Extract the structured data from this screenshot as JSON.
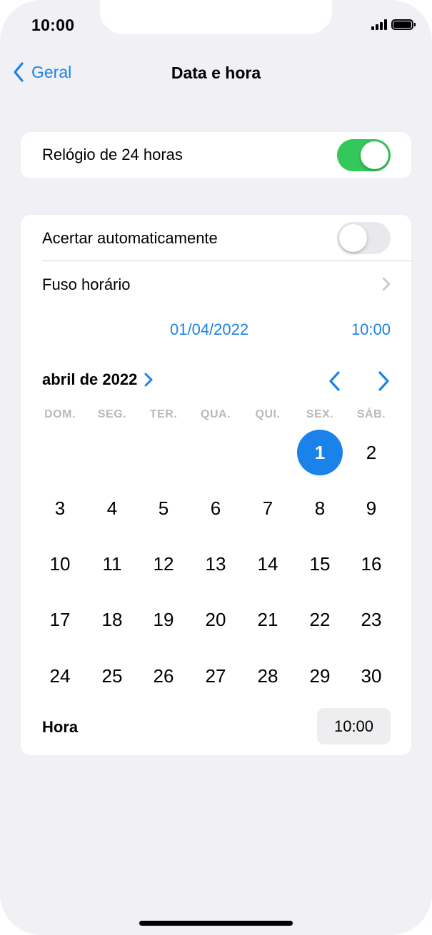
{
  "status_bar": {
    "time": "10:00"
  },
  "nav": {
    "back_label": "Geral",
    "title": "Data e hora"
  },
  "settings": {
    "clock_24h": {
      "label": "Relógio de 24 horas",
      "on": true
    },
    "auto_set": {
      "label": "Acertar automaticamente",
      "on": false
    },
    "timezone": {
      "label": "Fuso horário"
    }
  },
  "datetime": {
    "date": "01/04/2022",
    "time": "10:00"
  },
  "calendar": {
    "month_label": "abril de 2022",
    "weekdays": [
      "DOM.",
      "SEG.",
      "TER.",
      "QUA.",
      "QUI.",
      "SEX.",
      "SÁB."
    ],
    "selected_day": "1",
    "weeks": [
      [
        "",
        "",
        "",
        "",
        "",
        "1",
        "2"
      ],
      [
        "3",
        "4",
        "5",
        "6",
        "7",
        "8",
        "9"
      ],
      [
        "10",
        "11",
        "12",
        "13",
        "14",
        "15",
        "16"
      ],
      [
        "17",
        "18",
        "19",
        "20",
        "21",
        "22",
        "23"
      ],
      [
        "24",
        "25",
        "26",
        "27",
        "28",
        "29",
        "30"
      ]
    ]
  },
  "hora": {
    "label": "Hora",
    "value": "10:00"
  },
  "colors": {
    "accent": "#1a82e8",
    "toggle_on": "#34c759",
    "toggle_off": "#e9e9eb",
    "background": "#f0f0f5"
  }
}
